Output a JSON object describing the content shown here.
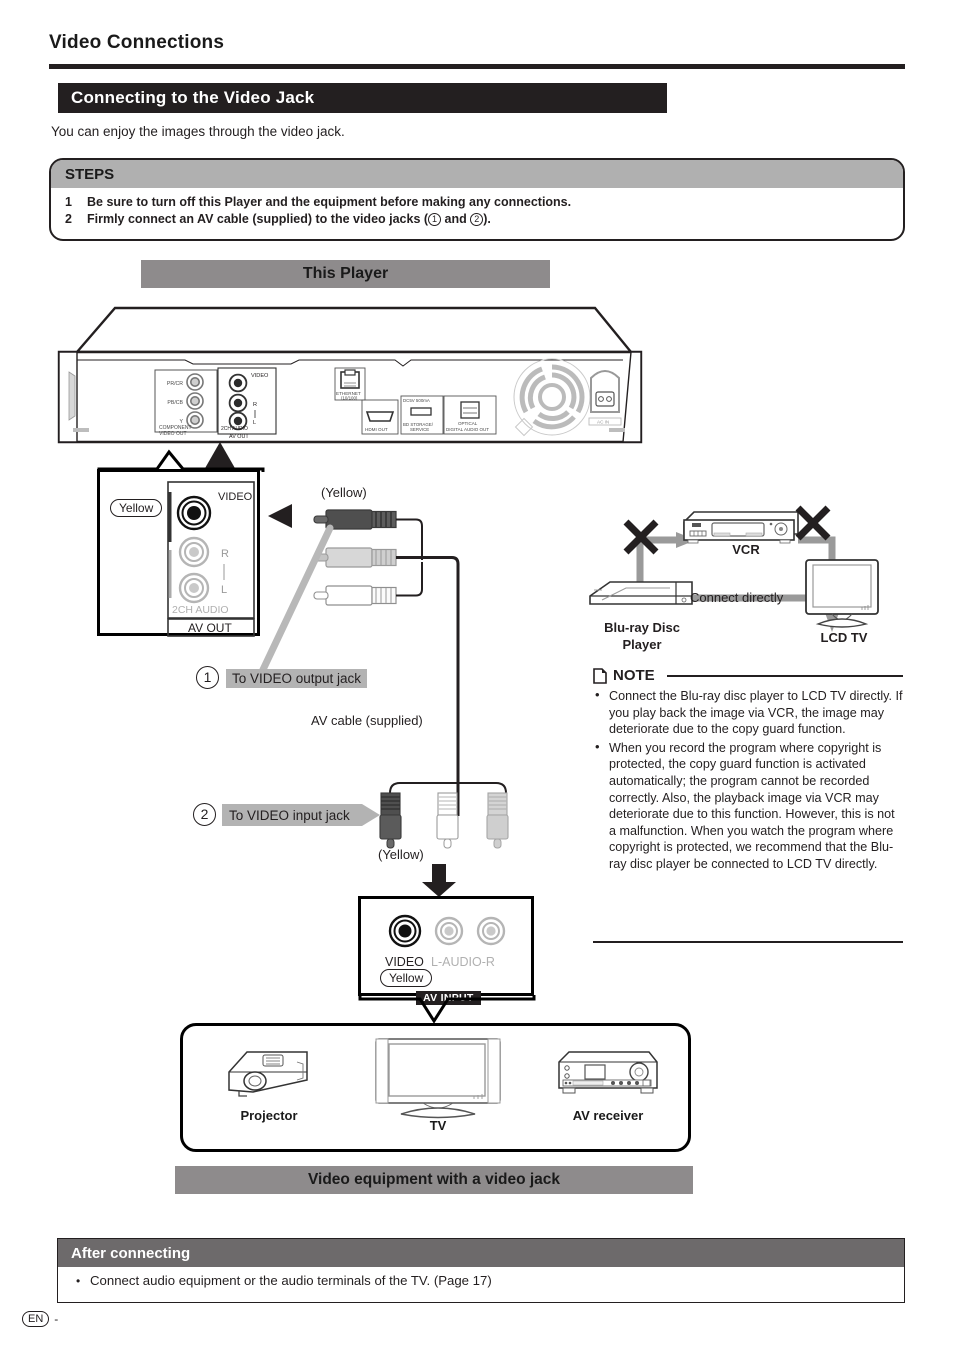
{
  "page": {
    "title": "Video Connections",
    "section_heading": "Connecting to the Video Jack",
    "intro": "You can enjoy the images through the video jack.",
    "footer_lang": "EN",
    "footer_dash": "-"
  },
  "steps": {
    "heading": "STEPS",
    "items": [
      {
        "num": "1",
        "text": "Be sure to turn off this Player and the equipment before making any connections."
      },
      {
        "num": "2",
        "text_before": "Firmly connect an AV cable (supplied) to the video jacks (",
        "circle1": "1",
        "text_mid": " and ",
        "circle2": "2",
        "text_after": ")."
      }
    ]
  },
  "player": {
    "banner": "This Player",
    "rear_panel_labels": {
      "pr_cr": "PR/CR",
      "pb_cb": "PB/CB",
      "y": "Y",
      "component_video_out": "COMPONENT VIDEO OUT",
      "video": "VIDEO",
      "r": "R",
      "l": "L",
      "two_ch_audio": "2CH AUDIO",
      "av_out": "AV OUT",
      "ethernet": "ETHERNET",
      "ethernet_sub": "(10/100)",
      "hdmi_out": "HDMI OUT",
      "dc5v": "DC5V 500mA",
      "bd_storage": "BD STORAGE/",
      "service": "SERVICE",
      "optical": "OPTICAL",
      "digital_audio_out": "DIGITAL AUDIO OUT",
      "ac_in": "AC IN"
    }
  },
  "jack_closeup": {
    "yellow_tag": "Yellow",
    "video": "VIDEO",
    "r": "R",
    "l": "L",
    "two_ch_audio": "2CH AUDIO",
    "av_out": "AV OUT"
  },
  "cable": {
    "yellow_top": "(Yellow)",
    "yellow_bottom": "(Yellow)",
    "cable_name": "AV cable (supplied)"
  },
  "callouts": [
    {
      "num": "1",
      "label": "To VIDEO output jack"
    },
    {
      "num": "2",
      "label": "To VIDEO input jack"
    }
  ],
  "vcr_diagram": {
    "vcr": "VCR",
    "lcd_tv": "LCD TV",
    "player_line1": "Blu-ray Disc",
    "player_line2": "Player",
    "connect_directly": "Connect directly"
  },
  "note": {
    "heading": "NOTE",
    "items": [
      "Connect the Blu-ray disc player to LCD TV directly. If you play back the image via VCR, the image may deteriorate due to the copy guard function.",
      "When you record the program where copyright is protected, the copy guard function is activated automatically; the program cannot be recorded correctly. Also, the playback image via VCR may deteriorate due to this function. However, this is not a malfunction. When you watch the program where copyright is protected, we recommend that the Blu-ray disc player be connected to LCD TV directly."
    ]
  },
  "av_input": {
    "video": "VIDEO",
    "l_audio_r": "L-AUDIO-R",
    "yellow_tag": "Yellow",
    "tag": "AV INPUT"
  },
  "equipment": {
    "banner": "Video equipment with a video jack",
    "items": [
      {
        "label": "Projector",
        "icon": "projector-icon"
      },
      {
        "label": "TV",
        "icon": "tv-icon"
      },
      {
        "label": "AV receiver",
        "icon": "av-receiver-icon"
      }
    ]
  },
  "after_connecting": {
    "heading": "After connecting",
    "bullet": "•",
    "text": "Connect audio equipment or the audio terminals of the TV. (Page 17)"
  },
  "colors": {
    "black": "#231f20",
    "banner_gray": "#8e8b8c",
    "steps_gray": "#b0b0b0",
    "highlight_gray": "#b3b3b3",
    "after_gray": "#6d6a6b"
  }
}
